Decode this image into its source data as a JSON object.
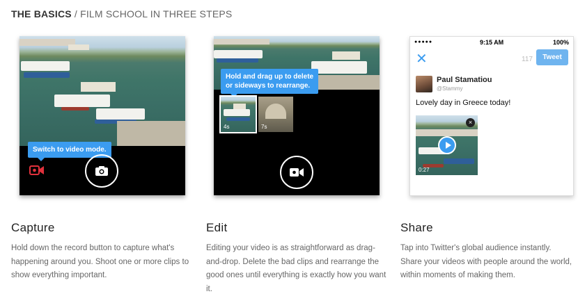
{
  "header": {
    "strong": "THE BASICS",
    "separator": " / ",
    "rest": "FILM SCHOOL IN THREE STEPS"
  },
  "capture": {
    "tooltip": "Switch to video mode.",
    "record_icon": "video-camera-icon",
    "shutter_icon": "camera-icon",
    "title": "Capture",
    "description": "Hold down the record button to capture what's happening around you. Shoot one or more clips to show everything important."
  },
  "edit": {
    "tooltip_line1": "Hold and drag up to delete",
    "tooltip_line2": "or sideways to rearrange.",
    "clips": [
      {
        "duration": "4s"
      },
      {
        "duration": "7s"
      }
    ],
    "record_icon": "video-camera-icon",
    "title": "Edit",
    "description": "Editing your video is as straightforward as drag-and-drop. Delete the bad clips and rearrange the good ones until everything is exactly how you want it."
  },
  "share": {
    "status": {
      "time": "9:15 AM",
      "battery": "100%"
    },
    "close": "✕",
    "char_count": "117",
    "tweet_button": "Tweet",
    "user_name": "Paul Stamatiou",
    "user_handle": "@Stammy",
    "tweet_text": "Lovely day in Greece today!",
    "video_duration": "0:27",
    "remove": "×",
    "title": "Share",
    "description": "Tap into Twitter's global audience instantly. Share your videos with people around the world, within moments of making them."
  },
  "colors": {
    "accent": "#3b9cf0",
    "record_red": "#e0313c",
    "tweet_button": "#6fb4ef"
  }
}
